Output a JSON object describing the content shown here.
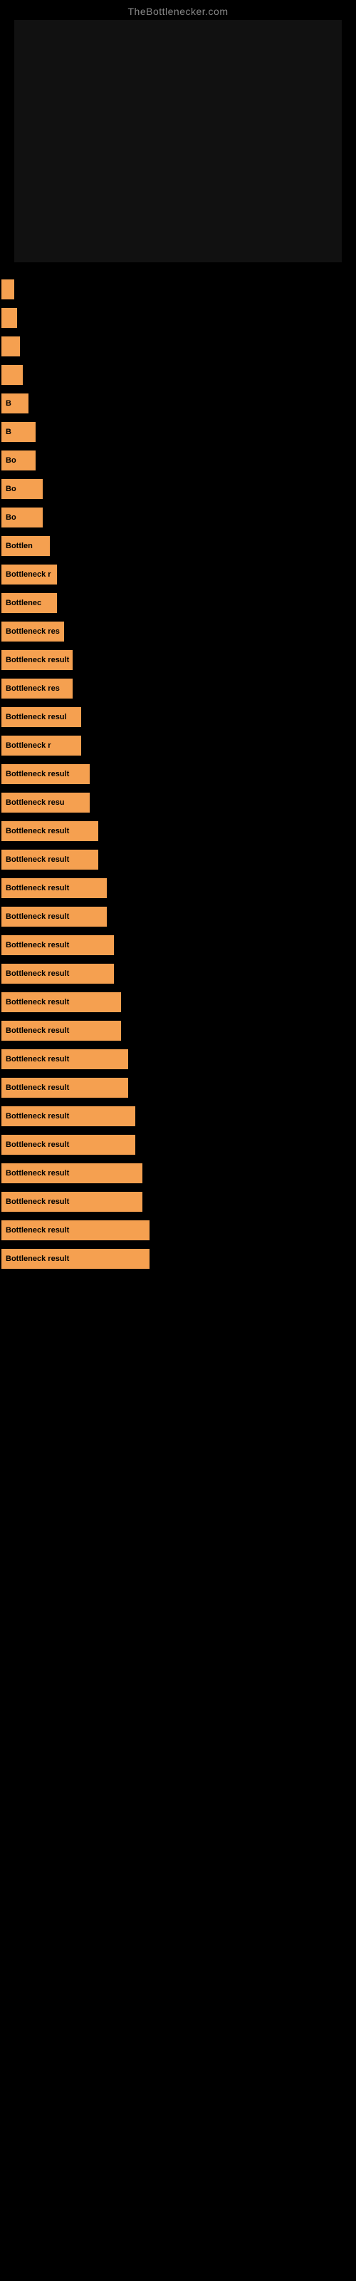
{
  "site": {
    "title": "TheBottlenecker.com"
  },
  "items": [
    {
      "id": 1,
      "label": "",
      "widthClass": "w1"
    },
    {
      "id": 2,
      "label": "",
      "widthClass": "w2"
    },
    {
      "id": 3,
      "label": "",
      "widthClass": "w3"
    },
    {
      "id": 4,
      "label": "",
      "widthClass": "w4"
    },
    {
      "id": 5,
      "label": "B",
      "widthClass": "w5"
    },
    {
      "id": 6,
      "label": "B",
      "widthClass": "w6"
    },
    {
      "id": 7,
      "label": "Bo",
      "widthClass": "w6"
    },
    {
      "id": 8,
      "label": "Bo",
      "widthClass": "w7"
    },
    {
      "id": 9,
      "label": "Bo",
      "widthClass": "w7"
    },
    {
      "id": 10,
      "label": "Bottlen",
      "widthClass": "w8"
    },
    {
      "id": 11,
      "label": "Bottleneck r",
      "widthClass": "w9"
    },
    {
      "id": 12,
      "label": "Bottlenec",
      "widthClass": "w9"
    },
    {
      "id": 13,
      "label": "Bottleneck res",
      "widthClass": "w10"
    },
    {
      "id": 14,
      "label": "Bottleneck result",
      "widthClass": "w11"
    },
    {
      "id": 15,
      "label": "Bottleneck res",
      "widthClass": "w11"
    },
    {
      "id": 16,
      "label": "Bottleneck resul",
      "widthClass": "w12"
    },
    {
      "id": 17,
      "label": "Bottleneck r",
      "widthClass": "w12"
    },
    {
      "id": 18,
      "label": "Bottleneck result",
      "widthClass": "w13"
    },
    {
      "id": 19,
      "label": "Bottleneck resu",
      "widthClass": "w13"
    },
    {
      "id": 20,
      "label": "Bottleneck result",
      "widthClass": "w14"
    },
    {
      "id": 21,
      "label": "Bottleneck result",
      "widthClass": "w14"
    },
    {
      "id": 22,
      "label": "Bottleneck result",
      "widthClass": "w15"
    },
    {
      "id": 23,
      "label": "Bottleneck result",
      "widthClass": "w15"
    },
    {
      "id": 24,
      "label": "Bottleneck result",
      "widthClass": "w16"
    },
    {
      "id": 25,
      "label": "Bottleneck result",
      "widthClass": "w16"
    },
    {
      "id": 26,
      "label": "Bottleneck result",
      "widthClass": "w17"
    },
    {
      "id": 27,
      "label": "Bottleneck result",
      "widthClass": "w17"
    },
    {
      "id": 28,
      "label": "Bottleneck result",
      "widthClass": "w18"
    },
    {
      "id": 29,
      "label": "Bottleneck result",
      "widthClass": "w18"
    },
    {
      "id": 30,
      "label": "Bottleneck result",
      "widthClass": "w19"
    },
    {
      "id": 31,
      "label": "Bottleneck result",
      "widthClass": "w19"
    },
    {
      "id": 32,
      "label": "Bottleneck result",
      "widthClass": "w20"
    },
    {
      "id": 33,
      "label": "Bottleneck result",
      "widthClass": "w20"
    },
    {
      "id": 34,
      "label": "Bottleneck result",
      "widthClass": "w21"
    },
    {
      "id": 35,
      "label": "Bottleneck result",
      "widthClass": "w21"
    }
  ]
}
